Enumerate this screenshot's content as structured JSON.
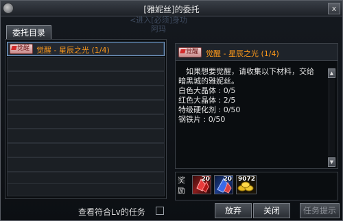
{
  "window": {
    "title": "[雅妮丝]的委托",
    "close_label": "x"
  },
  "background_text": {
    "line1": "<进入[必须]身功",
    "line2": "阿玛"
  },
  "tabs": [
    {
      "label": "委托目录"
    }
  ],
  "quest_list": {
    "items": [
      {
        "badge": "觉醒",
        "name": "觉醒 - 星辰之光 (1/4)",
        "selected": true
      }
    ],
    "empty_rows": 11
  },
  "filter": {
    "label": "查看符合Lv的任务",
    "checked": false
  },
  "detail": {
    "badge": "觉醒",
    "title": "觉醒 - 星辰之光 (1/4)",
    "description_lines": [
      "　如果想要觉醒，请收集以下材料，交给",
      "暗黑城的雅妮丝。",
      "白色大晶体 : 0/5",
      "红色大晶体 : 2/5",
      "特级硬化剂 : 0/50",
      "钢铁片 : 0/50"
    ]
  },
  "reward": {
    "label": "奖励",
    "items": [
      {
        "icon": "red-crystal-icon",
        "qty": "20"
      },
      {
        "icon": "blue-crystal-icon",
        "qty": "20"
      },
      {
        "icon": "gold-coins-icon",
        "qty": "9072"
      }
    ]
  },
  "buttons": {
    "abandon": "放弃",
    "close": "关闭",
    "hint": "任务提示"
  },
  "colors": {
    "quest_name": "#ff9a1a",
    "selected_border": "#7fa0c8"
  }
}
